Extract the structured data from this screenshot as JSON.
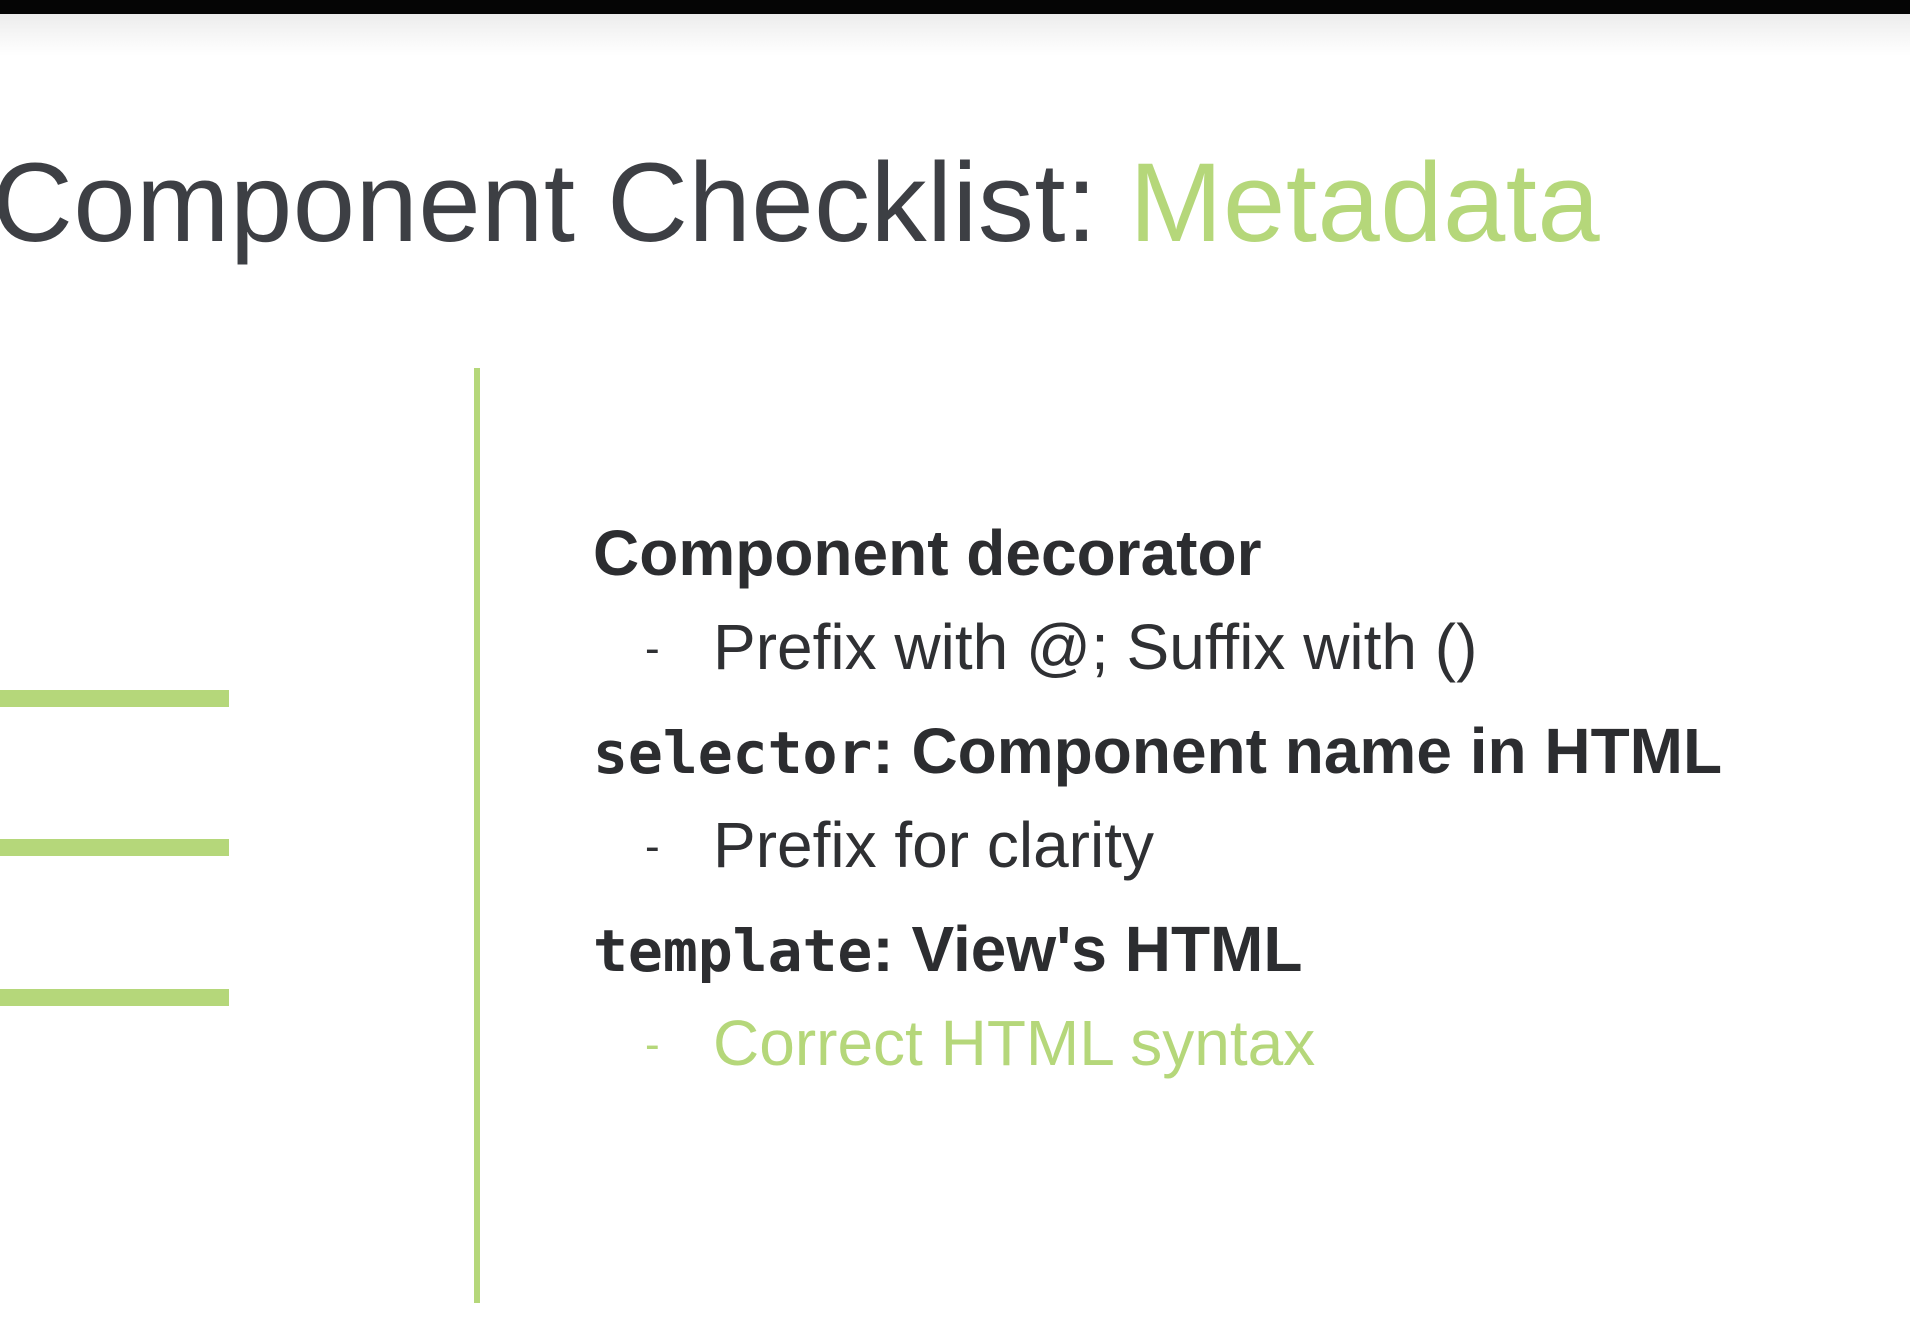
{
  "slide": {
    "title_main": "Component Checklist: ",
    "title_accent": "Metadata",
    "accent_color": "#b5d77a",
    "text_color": "#3d3f44"
  },
  "checklist": [
    {
      "code": "",
      "label": "Component decorator",
      "detail_marker": "-",
      "detail": "Prefix with @; Suffix with ()",
      "detail_highlighted": false
    },
    {
      "code": "selector",
      "label": ": Component name in HTML",
      "detail_marker": "-",
      "detail": "Prefix for clarity",
      "detail_highlighted": false
    },
    {
      "code": "template",
      "label": ": View's HTML",
      "detail_marker": "-",
      "detail": "Correct HTML syntax",
      "detail_highlighted": true
    }
  ]
}
